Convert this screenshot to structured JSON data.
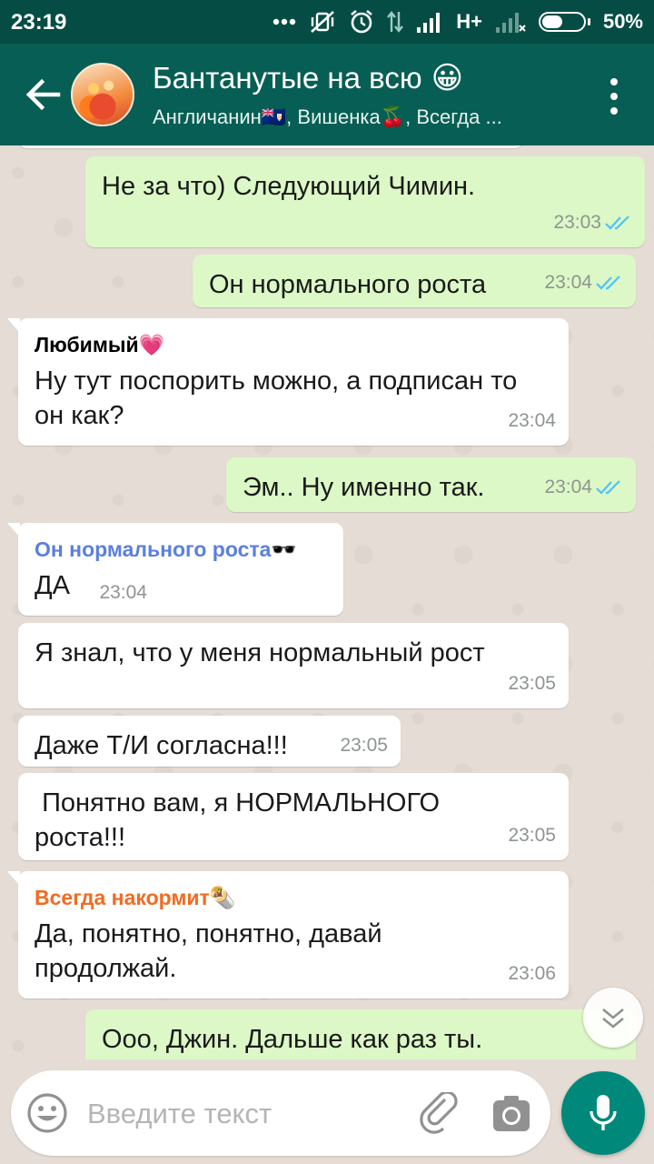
{
  "status_bar": {
    "time": "23:19",
    "network": "H+",
    "battery": "50%",
    "icons": [
      "more-dots-icon",
      "muted-vibrate-icon",
      "alarm-icon",
      "data-arrows-icon",
      "signal-icon",
      "signal-weak-icon",
      "battery-icon"
    ]
  },
  "header": {
    "title": "Бантанутые на всю",
    "title_emoji": "😀",
    "subtitle": "Англичанин🇦🇮, Вишенка🍒, Всегда ..."
  },
  "messages": [
    {
      "direction": "out",
      "text": "Не за что) Следующий Чимин.",
      "time": "23:03",
      "status": "read"
    },
    {
      "direction": "out",
      "text": "Он нормального роста",
      "time": "23:04",
      "status": "read"
    },
    {
      "direction": "in",
      "sender": "Любимый💗",
      "sender_color": "#000000",
      "text": "Ну тут поспорить можно, а подписан то он как?",
      "time": "23:04"
    },
    {
      "direction": "out",
      "text": "Эм.. Ну именно так.",
      "time": "23:04",
      "status": "read"
    },
    {
      "direction": "in",
      "sender": "Он нормального роста🕶️",
      "sender_color": "#5a7fe0",
      "text": "ДА",
      "time": "23:04"
    },
    {
      "direction": "in",
      "text": "Я знал, что у меня нормальный рост",
      "time": "23:05"
    },
    {
      "direction": "in",
      "text": "Даже Т/И согласна!!!",
      "time": "23:05"
    },
    {
      "direction": "in",
      "text": " Понятно вам, я НОРМАЛЬНОГО роста!!!",
      "time": "23:05"
    },
    {
      "direction": "in",
      "sender": "Всегда накормит🌯",
      "sender_color": "#f26b21",
      "text": "Да, понятно, понятно, давай продолжай.",
      "time": "23:06"
    },
    {
      "direction": "out",
      "text": "Ооо, Джин. Дальше как раз ты.",
      "time": "",
      "status": ""
    }
  ],
  "input": {
    "placeholder": "Введите текст",
    "value": ""
  },
  "colors": {
    "status_bar": "#054d44",
    "app_bar": "#075e54",
    "outgoing_bubble": "#dcf8c6",
    "incoming_bubble": "#ffffff",
    "read_check": "#4fc3f7",
    "mic_button": "#00897b"
  }
}
